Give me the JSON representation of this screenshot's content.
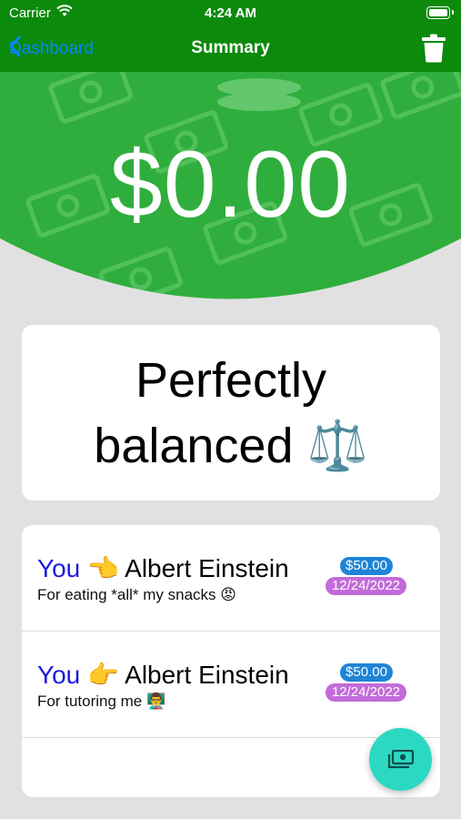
{
  "status_bar": {
    "carrier": "Carrier",
    "time": "4:24 AM"
  },
  "nav": {
    "back_label": "Dashboard",
    "title": "Summary"
  },
  "summary": {
    "total_amount": "$0.00"
  },
  "balance": {
    "text": "Perfectly balanced ⚖️"
  },
  "transactions": [
    {
      "from": "You",
      "direction_emoji": "👈",
      "to": "Albert Einstein",
      "note": "For eating *all* my snacks 😡",
      "amount": "$50.00",
      "date": "12/24/2022"
    },
    {
      "from": "You",
      "direction_emoji": "👉",
      "to": "Albert Einstein",
      "note": "For tutoring me 👨‍🏫",
      "amount": "$50.00",
      "date": "12/24/2022"
    }
  ],
  "icons": {
    "back": "chevron-left-icon",
    "trash": "trash-icon",
    "fab": "money-icon",
    "wifi": "wifi-icon",
    "battery": "battery-icon"
  },
  "colors": {
    "header_green": "#0c8a0c",
    "hero_green": "#2fae3d",
    "accent_blue": "#0a84ff",
    "amount_badge": "#1f84d6",
    "date_badge": "#c36bd8",
    "fab": "#2bd9c3",
    "you_text": "#1a1ae0"
  }
}
